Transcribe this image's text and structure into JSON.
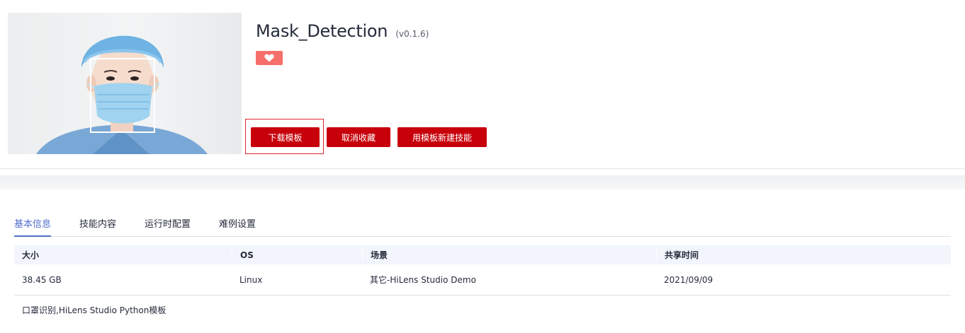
{
  "header": {
    "title": "Mask_Detection",
    "version": "(v0.1.6)",
    "favorite_icon": "heart-icon"
  },
  "actions": {
    "download_label": "下载模板",
    "unfavorite_label": "取消收藏",
    "new_skill_label": "用模板新建技能"
  },
  "tabs": [
    {
      "label": "基本信息",
      "active": true
    },
    {
      "label": "技能内容",
      "active": false
    },
    {
      "label": "运行时配置",
      "active": false
    },
    {
      "label": "难例设置",
      "active": false
    }
  ],
  "table": {
    "headers": [
      "大小",
      "OS",
      "场景",
      "共享时间"
    ],
    "row": [
      "38.45 GB",
      "Linux",
      "其它-HiLens Studio Demo",
      "2021/09/09"
    ]
  },
  "description": "口罩识别,HiLens Studio Python模板",
  "colors": {
    "primary": "#c7000b",
    "favorite": "#f66f6a",
    "tab_active": "#526ecc",
    "table_header_bg": "#f2f5fc"
  }
}
